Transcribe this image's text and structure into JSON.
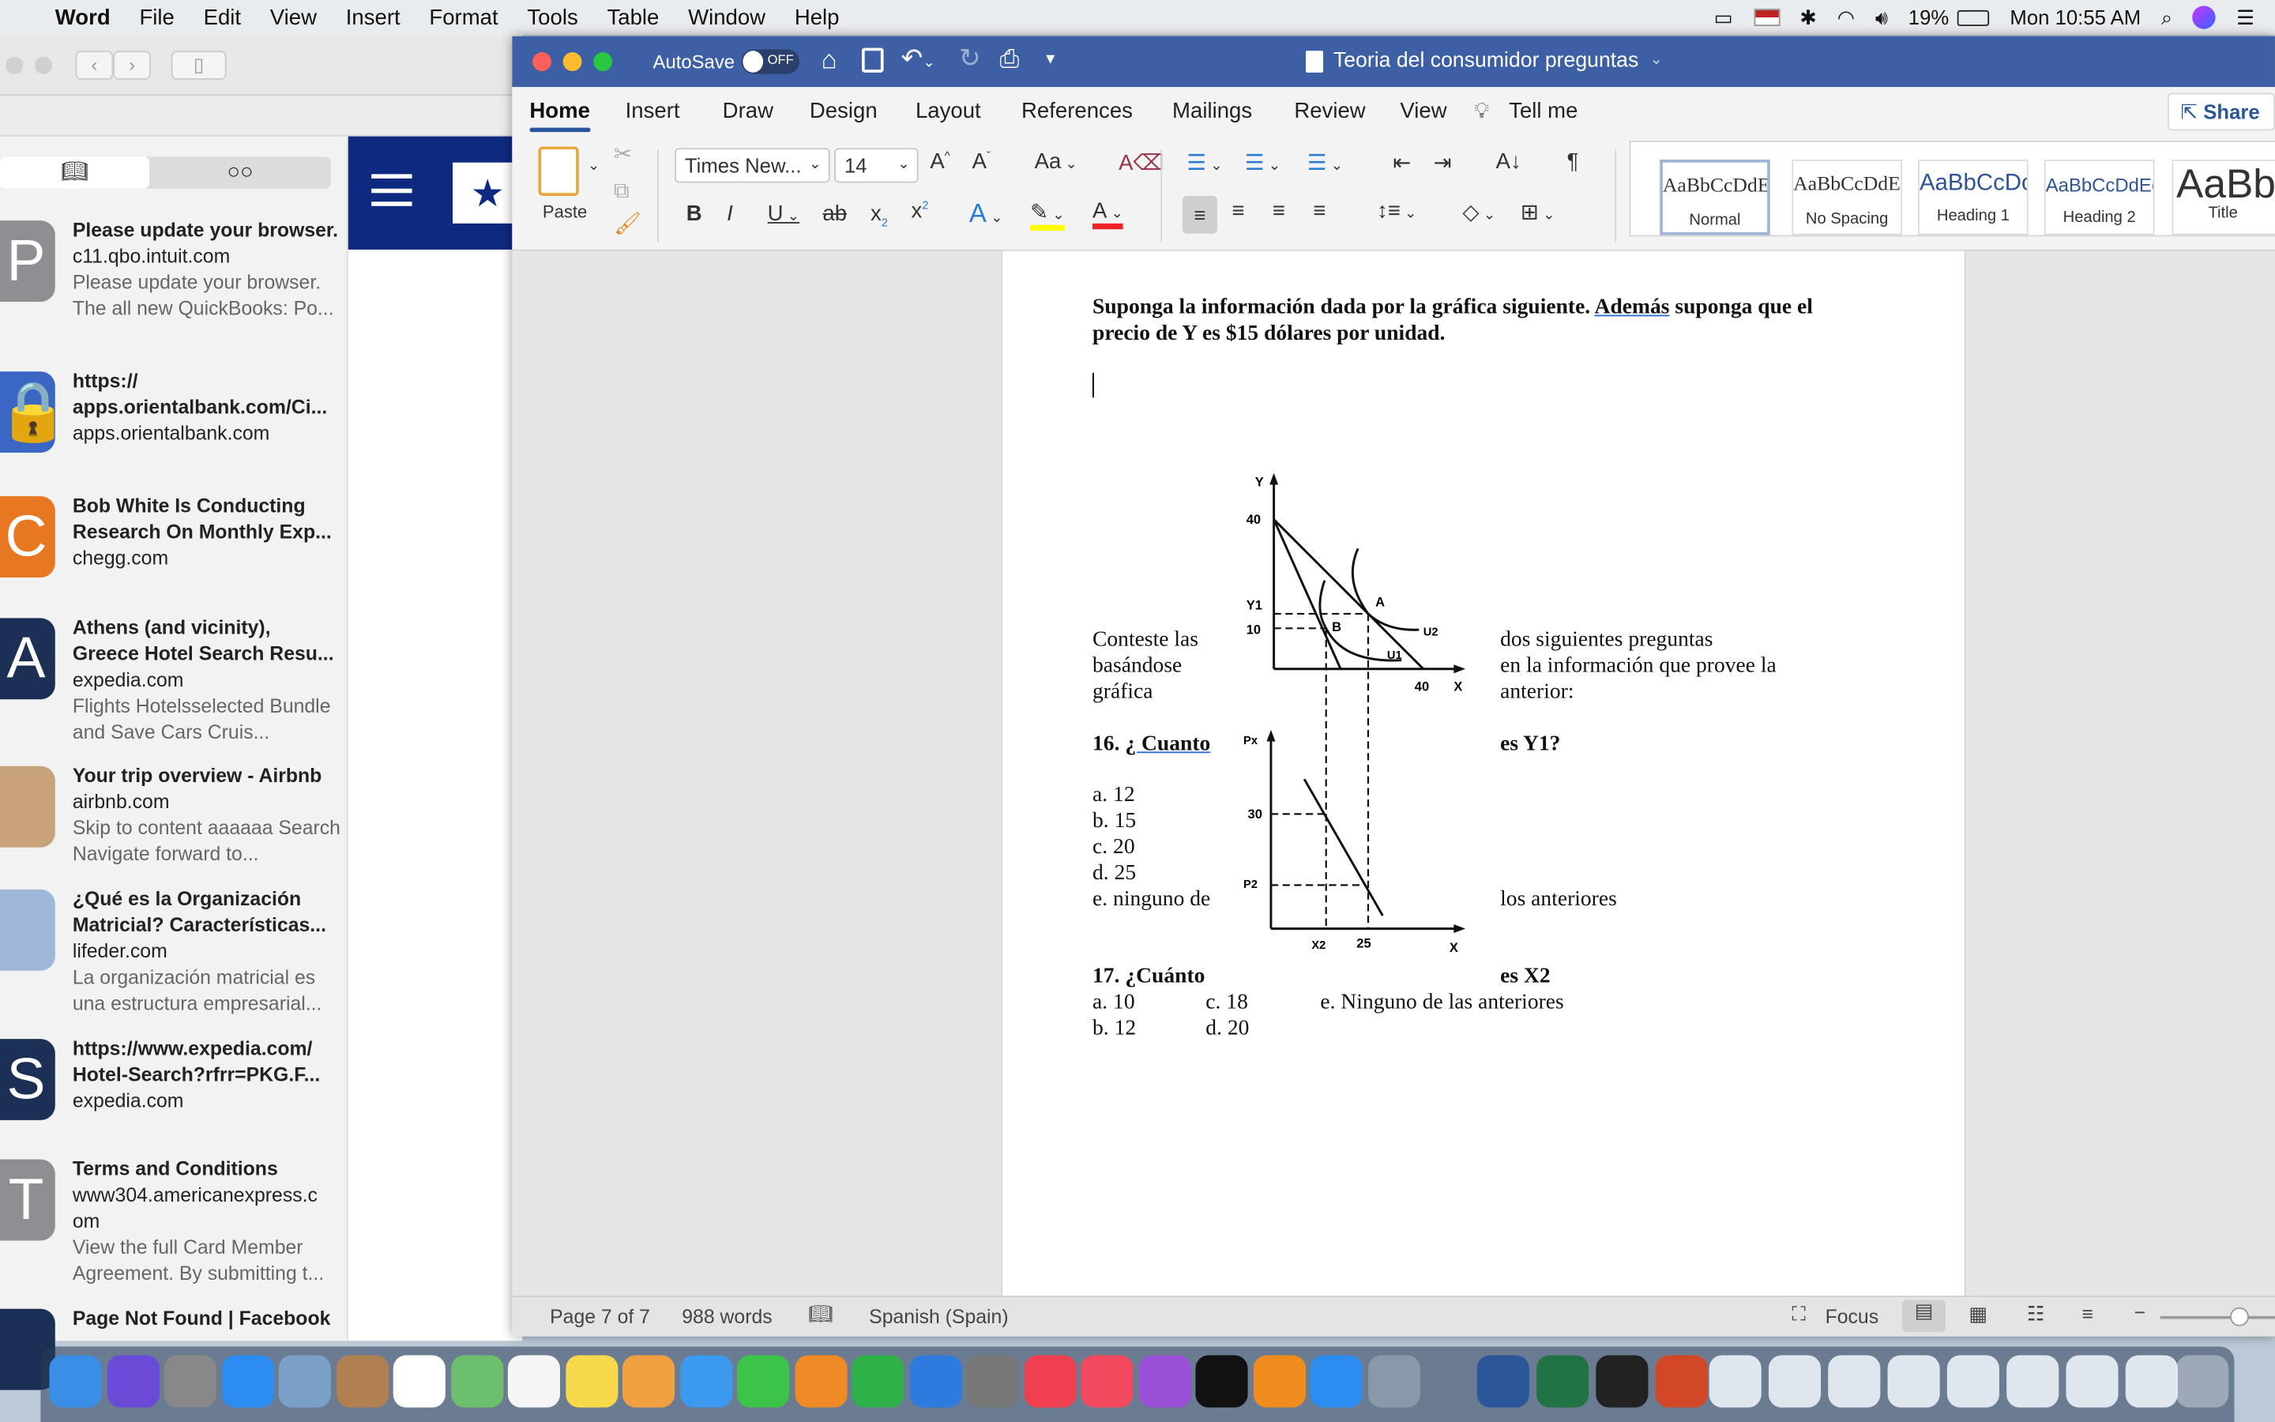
{
  "menubar": {
    "apple": "",
    "app": "Word",
    "items": [
      "File",
      "Edit",
      "View",
      "Insert",
      "Format",
      "Tools",
      "Table",
      "Window",
      "Help"
    ],
    "battery": "19%",
    "clock": "Mon 10:55 AM"
  },
  "safari": {
    "reading_list": [
      {
        "letter": "P",
        "color": "#8e8e93",
        "title": "Please update your browser.",
        "url": "c11.qbo.intuit.com",
        "desc": "Please update your browser. The all new QuickBooks: Po..."
      },
      {
        "letter": "🔒",
        "color": "#3b67c4",
        "title": "https:// apps.orientalbank.com/Ci...",
        "url": "apps.orientalbank.com",
        "desc": ""
      },
      {
        "letter": "C",
        "color": "#e87722",
        "title": "Bob White Is Conducting Research On Monthly Exp...",
        "url": "chegg.com",
        "desc": ""
      },
      {
        "letter": "A",
        "color": "#1c2f55",
        "title": "Athens (and vicinity), Greece Hotel Search Resu...",
        "url": "expedia.com",
        "desc": "Flights Hotelsselected Bundle and Save Cars Cruis..."
      },
      {
        "letter": "",
        "color": "#c8a27a",
        "title": "Your trip overview - Airbnb",
        "url": "airbnb.com",
        "desc": "Skip to content aaaaaa Search Navigate forward to..."
      },
      {
        "letter": "",
        "color": "#9fb7d8",
        "title": "¿Qué es la Organización Matricial? Características...",
        "url": "lifeder.com",
        "desc": "La organización matricial es una estructura empresarial..."
      },
      {
        "letter": "S",
        "color": "#1c2f55",
        "title": "https://www.expedia.com/ Hotel-Search?rfrr=PKG.F...",
        "url": "expedia.com",
        "desc": ""
      },
      {
        "letter": "T",
        "color": "#8e8e93",
        "title": "Terms and Conditions",
        "url": "www304.americanexpress.c om",
        "desc": "View the full Card Member Agreement. By submitting t..."
      },
      {
        "letter": "",
        "color": "#1c2f55",
        "title": "Page Not Found | Facebook",
        "url": "",
        "desc": ""
      }
    ]
  },
  "word": {
    "autosave": "AutoSave",
    "autosave_state": "OFF",
    "title": "Teoria del consumidor preguntas",
    "tabs": [
      "Home",
      "Insert",
      "Draw",
      "Design",
      "Layout",
      "References",
      "Mailings",
      "Review",
      "View",
      "Tell me"
    ],
    "share": "Share",
    "paste": "Paste",
    "font": "Times New...",
    "size": "14",
    "styles": [
      {
        "preview": "AaBbCcDdEe",
        "name": "Normal"
      },
      {
        "preview": "AaBbCcDdEe",
        "name": "No Spacing"
      },
      {
        "preview": "AaBbCcDc",
        "name": "Heading 1"
      },
      {
        "preview": "AaBbCcDdEe",
        "name": "Heading 2"
      },
      {
        "preview": "AaBb",
        "name": "Title"
      }
    ],
    "status": {
      "page": "Page 7 of 7",
      "words": "988 words",
      "language": "Spanish (Spain)",
      "focus": "Focus"
    }
  },
  "document": {
    "intro1": "Suponga la información dada por la gráfica siguiente. ",
    "intro_underlined": "Además",
    "intro2": " suponga que el",
    "intro3": "precio de Y es $15 dólares por unidad.",
    "left": [
      "Conteste las",
      "basándose",
      "gráfica"
    ],
    "right": [
      "dos siguientes preguntas",
      "en la información que provee la",
      "anterior:"
    ],
    "q16_num": "16. ",
    "q16": "¿ Cuanto",
    "q16_end": "es Y1?",
    "q16_options": [
      "a. 12",
      "b. 15",
      "c. 20",
      "d. 25",
      "e. ninguno de"
    ],
    "q16_options_end": "los anteriores",
    "q17": "17. ¿Cuánto",
    "q17_end": "es X2",
    "q17_options": [
      "a. 10",
      "c. 18",
      "e. Ninguno de las anteriores",
      "b. 12",
      "d. 20"
    ],
    "graph": {
      "top": {
        "y_axis": "Y",
        "x_axis": "X",
        "y_ticks": [
          "40",
          "Y1",
          "10"
        ],
        "x_ticks": [
          "40"
        ],
        "points": [
          "A",
          "B"
        ],
        "curves": [
          "U2",
          "U1"
        ]
      },
      "bottom": {
        "y_axis": "Px",
        "x_axis": "X",
        "y_ticks": [
          "30",
          "P2"
        ],
        "x_ticks": [
          "X2",
          "25"
        ]
      }
    }
  },
  "dock": [
    {
      "name": "Finder",
      "color": "#3a8ee6"
    },
    {
      "name": "Siri",
      "color": "#6a4bd8"
    },
    {
      "name": "Launchpad",
      "color": "#888"
    },
    {
      "name": "Safari",
      "color": "#2d8cf0"
    },
    {
      "name": "Preview",
      "color": "#7aa0c8"
    },
    {
      "name": "Contacts",
      "color": "#b08050"
    },
    {
      "name": "Calendar",
      "color": "#ffffff"
    },
    {
      "name": "Maps",
      "color": "#6cbf6c"
    },
    {
      "name": "Reminders",
      "color": "#f5f5f5"
    },
    {
      "name": "Notes",
      "color": "#f7d84a"
    },
    {
      "name": "Photos",
      "color": "#f0a040"
    },
    {
      "name": "Messages",
      "color": "#3b9af0"
    },
    {
      "name": "FaceTime",
      "color": "#3cc34a"
    },
    {
      "name": "Pages",
      "color": "#f08a24"
    },
    {
      "name": "Numbers",
      "color": "#2fb14a"
    },
    {
      "name": "Keynote",
      "color": "#2e7be0"
    },
    {
      "name": "System Preferences",
      "color": "#777"
    },
    {
      "name": "News",
      "color": "#f04050"
    },
    {
      "name": "Music",
      "color": "#f2495e"
    },
    {
      "name": "Podcasts",
      "color": "#9b4fd6"
    },
    {
      "name": "TV",
      "color": "#111"
    },
    {
      "name": "Books",
      "color": "#f08c1e"
    },
    {
      "name": "App Store",
      "color": "#2d8cf0"
    },
    {
      "name": "Preview",
      "color": "#8899aa"
    },
    {
      "name": "Word",
      "color": "#2b579a"
    },
    {
      "name": "Excel",
      "color": "#217346"
    },
    {
      "name": "Activity Monitor",
      "color": "#222"
    },
    {
      "name": "PowerPoint",
      "color": "#d24726"
    }
  ]
}
